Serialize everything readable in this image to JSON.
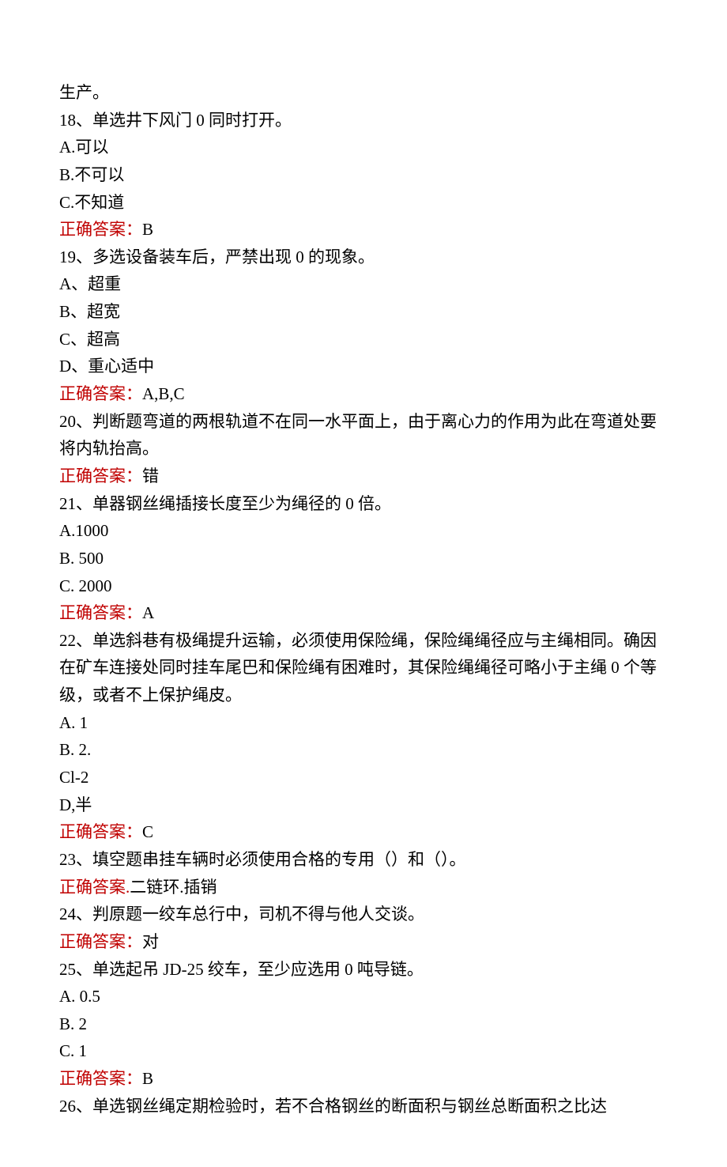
{
  "fragment_top": "生产。",
  "q18": {
    "stem": "18、单选井下风门 0 同时打开。",
    "optA": "A.可以",
    "optB": "B.不可以",
    "optC": "C.不知道",
    "ansLabel": "正确答案：",
    "ansVal": "B"
  },
  "q19": {
    "stem": "19、多选设备装车后，严禁出现 0 的现象。",
    "optA": "A、超重",
    "optB": "B、超宽",
    "optC": "C、超高",
    "optD": "D、重心适中",
    "ansLabel": "正确答案：",
    "ansVal": "A,B,C"
  },
  "q20": {
    "stem": "20、判断题弯道的两根轨道不在同一水平面上，由于离心力的作用为此在弯道处要将内轨抬高。",
    "ansLabel": "正确答案：",
    "ansVal": "错"
  },
  "q21": {
    "stem": "21、单器钢丝绳插接长度至少为绳径的 0 倍。",
    "optA": "A.1000",
    "optB": "B. 500",
    "optC": "C. 2000",
    "ansLabel": "正确答案：",
    "ansVal": "A"
  },
  "q22": {
    "stem": "22、单选斜巷有极绳提升运输，必须使用保险绳，保险绳绳径应与主绳相同。确因在矿车连接处同时挂车尾巴和保险绳有困难时，其保险绳绳径可略小于主绳 0 个等级，或者不上保护绳皮。",
    "optA": "A. 1",
    "optB": "B. 2.",
    "optC": "Cl-2",
    "optD": "D,半",
    "ansLabel": "正确答案：",
    "ansVal": "C"
  },
  "q23": {
    "stem": "23、填空题串挂车辆时必须使用合格的专用（）和（）。",
    "ansLabel": "正确答案.",
    "ansVal": "二链环.插销"
  },
  "q24": {
    "stem": "24、判原题一绞车总行中，司机不得与他人交谈。",
    "ansLabel": "正确答案：",
    "ansVal": "对"
  },
  "q25": {
    "stem": "25、单选起吊 JD-25 绞车，至少应选用 0 吨导链。",
    "optA": "A. 0.5",
    "optB": "B. 2",
    "optC": "C. 1",
    "ansLabel": "正确答案：",
    "ansVal": "B"
  },
  "q26": {
    "stem": "26、单选钢丝绳定期检验时，若不合格钢丝的断面积与钢丝总断面积之比达"
  }
}
